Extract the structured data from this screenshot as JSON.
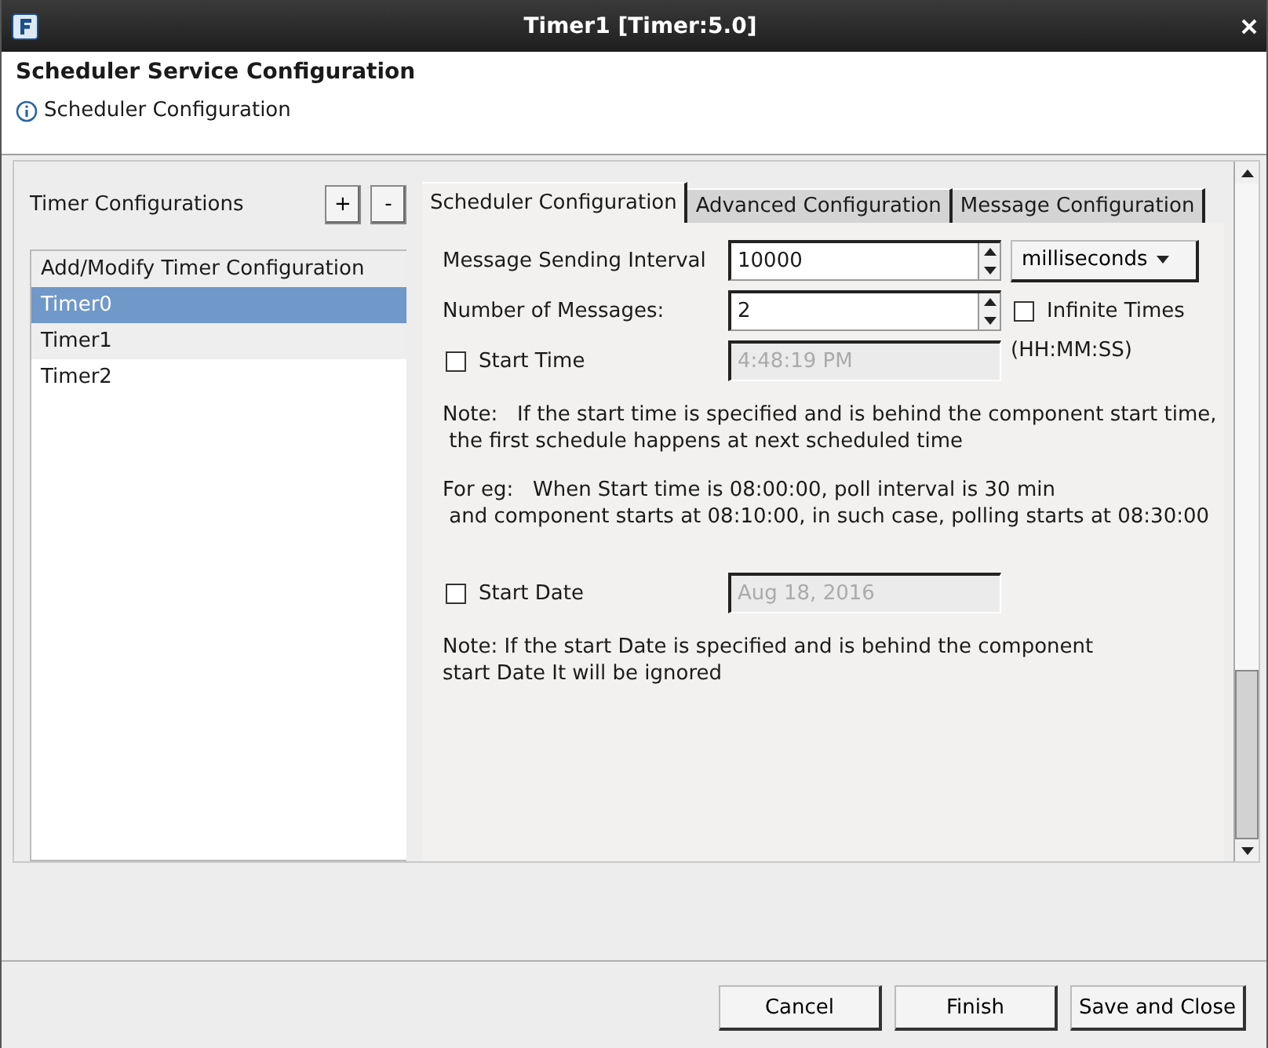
{
  "window": {
    "title": "Timer1 [Timer:5.0]"
  },
  "header": {
    "title": "Scheduler Service Configuration",
    "message": "Scheduler Configuration"
  },
  "timers": {
    "label": "Timer Configurations",
    "add": "+",
    "remove": "-",
    "items": [
      {
        "label": "Add/Modify Timer Configuration",
        "selected": false
      },
      {
        "label": "Timer0",
        "selected": true
      },
      {
        "label": "Timer1",
        "selected": false
      },
      {
        "label": "Timer2",
        "selected": false
      }
    ]
  },
  "tabs": [
    {
      "label": "Scheduler Configuration",
      "selected": true
    },
    {
      "label": "Advanced Configuration",
      "selected": false
    },
    {
      "label": "Message Configuration",
      "selected": false
    }
  ],
  "form": {
    "interval_label": "Message Sending Interval",
    "interval": "10000",
    "unit": "milliseconds",
    "count_label": "Number of Messages:",
    "count": "2",
    "infinite": {
      "label": "Infinite Times",
      "checked": false
    },
    "start_time": {
      "label": "Start Time",
      "checked": false,
      "value": "4:48:19 PM",
      "format": "(HH:MM:SS)"
    },
    "note1": "Note:   If the start time is specified and is behind the component start time,\n the first schedule happens at next scheduled time",
    "note2": "For eg:   When Start time is 08:00:00, poll interval is 30 min\n and component starts at 08:10:00, in such case, polling starts at 08:30:00",
    "start_date": {
      "label": "Start Date",
      "checked": false,
      "value": "Aug 18, 2016"
    },
    "note3": "Note: If the start Date is specified and is behind the component\nstart Date It will be ignored"
  },
  "buttons": [
    "Cancel",
    "Finish",
    "Save and Close"
  ]
}
